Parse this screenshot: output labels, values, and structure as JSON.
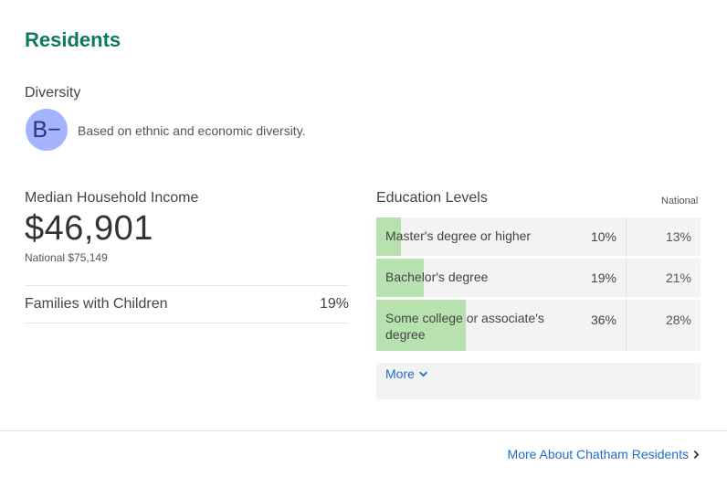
{
  "section_title": "Residents",
  "diversity": {
    "label": "Diversity",
    "grade": "B−",
    "description": "Based on ethnic and economic diversity."
  },
  "income": {
    "label": "Median Household Income",
    "value": "$46,901",
    "national": "National $75,149"
  },
  "families": {
    "label": "Families with Children",
    "value": "19%"
  },
  "education": {
    "title": "Education Levels",
    "national_label": "National",
    "rows": [
      {
        "label": "Master's degree or higher",
        "value": "10%",
        "national": "13%",
        "fraction": 0.1
      },
      {
        "label": "Bachelor's degree",
        "value": "19%",
        "national": "21%",
        "fraction": 0.19
      },
      {
        "label": "Some college or associate's degree",
        "value": "36%",
        "national": "28%",
        "fraction": 0.36
      }
    ],
    "more_label": "More"
  },
  "more_about": "More About Chatham Residents",
  "colors": {
    "accent": "#0d7a5f",
    "link": "#1f6ec7",
    "bar": "#b7e2b0",
    "grade_bg": "#a4b4ff"
  }
}
